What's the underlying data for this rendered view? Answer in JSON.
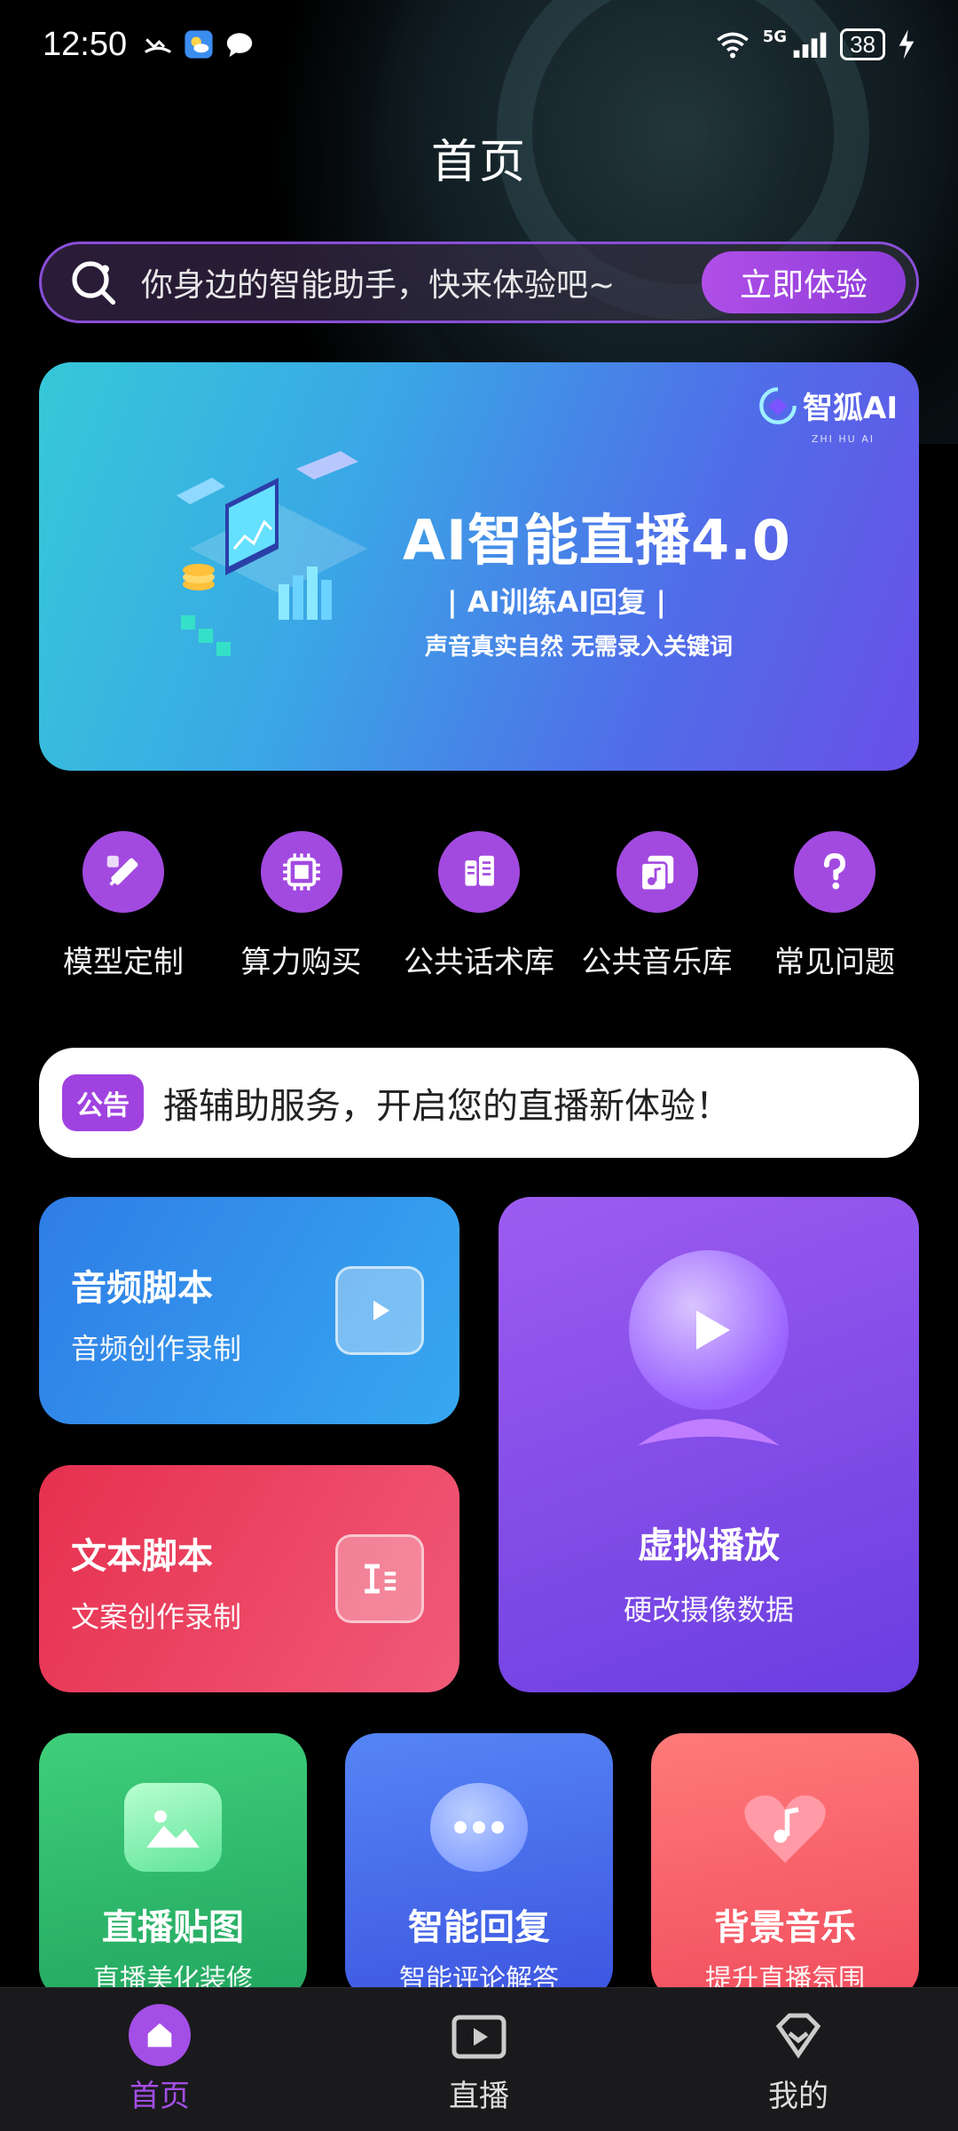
{
  "status_bar": {
    "time": "12:50",
    "network": "5G",
    "battery": "38"
  },
  "page": {
    "title": "首页"
  },
  "search": {
    "placeholder": "你身边的智能助手，快来体验吧~",
    "button_label": "立即体验"
  },
  "banner": {
    "logo_name": "智狐AI",
    "logo_sub": "ZHI HU AI",
    "title": "AI智能直播4.0",
    "subtitle": "| AI训练AI回复 |",
    "tagline": "声音真实自然  无需录入关键词"
  },
  "shortcuts": [
    {
      "label": "模型定制",
      "icon": "pen-ruler-icon"
    },
    {
      "label": "算力购买",
      "icon": "chip-icon"
    },
    {
      "label": "公共话术库",
      "icon": "script-library-icon"
    },
    {
      "label": "公共音乐库",
      "icon": "music-library-icon"
    },
    {
      "label": "常见问题",
      "icon": "question-icon"
    }
  ],
  "notice": {
    "tag": "公告",
    "text": "播辅助服务，开启您的直播新体验！"
  },
  "cards": {
    "audio": {
      "title": "音频脚本",
      "subtitle": "音频创作录制"
    },
    "text": {
      "title": "文本脚本",
      "subtitle": "文案创作录制"
    },
    "virtual": {
      "title": "虚拟播放",
      "subtitle": "硬改摄像数据"
    },
    "sticker": {
      "title": "直播贴图",
      "subtitle": "直播美化装修"
    },
    "reply": {
      "title": "智能回复",
      "subtitle": "智能评论解答"
    },
    "music": {
      "title": "背景音乐",
      "subtitle": "提升直播氛围"
    }
  },
  "bottom_nav": [
    {
      "label": "首页",
      "active": true
    },
    {
      "label": "直播",
      "active": false
    },
    {
      "label": "我的",
      "active": false
    }
  ]
}
